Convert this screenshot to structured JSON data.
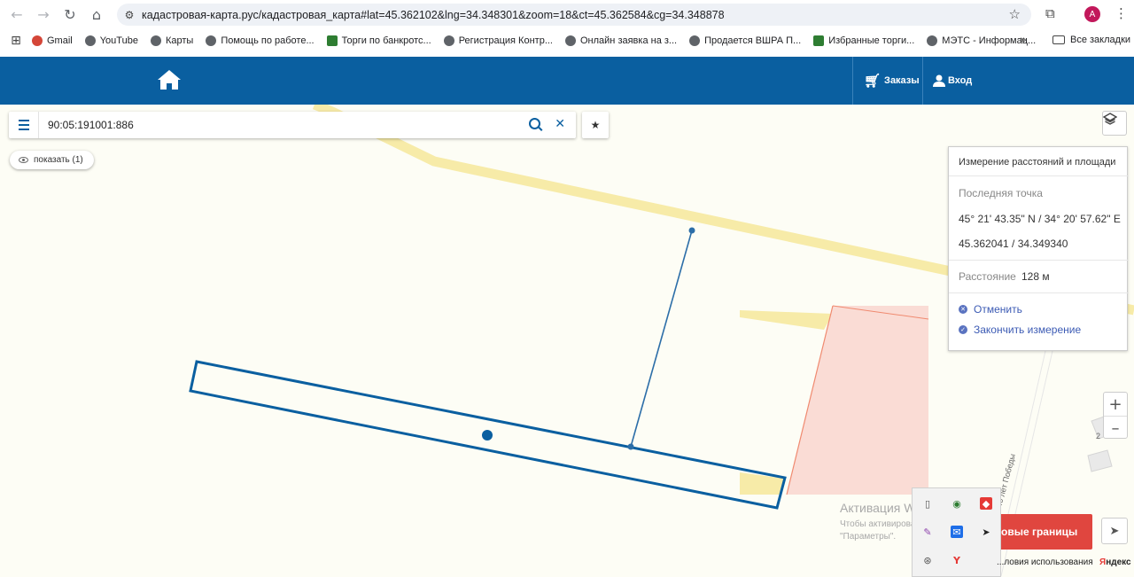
{
  "browser": {
    "url": "кадастровая-карта.рус/кадастровая_карта#lat=45.362102&lng=34.348301&zoom=18&ct=45.362584&cg=34.348878",
    "avatar_letter": "A",
    "bookmarks": [
      "Gmail",
      "YouTube",
      "Карты",
      "Помощь по работе...",
      "Торги по банкротс...",
      "Регистрация Контр...",
      "Онлайн заявка на з...",
      "Продается ВШРА П...",
      "Избранные торги...",
      "МЭТС - Информац..."
    ],
    "more": "»",
    "all_bookmarks": "Все закладки"
  },
  "header": {
    "orders_label": "Заказы",
    "login_label": "Вход",
    "brand_color": "#0a5fa0"
  },
  "search": {
    "value": "90:05:191001:886"
  },
  "show_pill": {
    "label": "показать (1)"
  },
  "measure_panel": {
    "title": "Измерение расстояний и площади",
    "last_point_label": "Последняя точка",
    "coords_dms": "45° 21' 43.35\" N / 34° 20' 57.62\" E",
    "coords_dec": "45.362041 / 34.349340",
    "distance_label": "Расстояние",
    "distance_value": "128 м",
    "cancel_label": "Отменить",
    "finish_label": "Закончить измерение"
  },
  "zoom": {
    "plus": "+",
    "minus": "–"
  },
  "map_labels": {
    "street": "40 лет Победы",
    "house": "2"
  },
  "red_button": {
    "label": "...тровые границы"
  },
  "watermark": {
    "line1": "Активация Windows",
    "line2": "Чтобы активировать Windows, перейдите в раздел \"Параметры\"."
  },
  "footer": {
    "terms": "...ловия использования",
    "yandex_y": "Я",
    "yandex_rest": "ндекс"
  }
}
